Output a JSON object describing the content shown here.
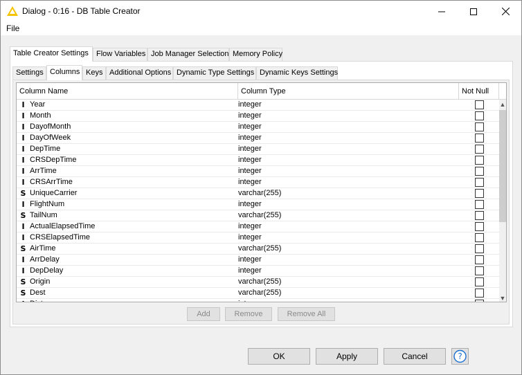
{
  "window": {
    "title": "Dialog - 0:16 - DB Table Creator"
  },
  "menu": {
    "file": "File"
  },
  "outer_tabs": [
    {
      "label": "Table Creator Settings",
      "active": true
    },
    {
      "label": "Flow Variables",
      "active": false
    },
    {
      "label": "Job Manager Selection",
      "active": false
    },
    {
      "label": "Memory Policy",
      "active": false
    }
  ],
  "inner_tabs": [
    {
      "label": "Settings",
      "active": false
    },
    {
      "label": "Columns",
      "active": true
    },
    {
      "label": "Keys",
      "active": false
    },
    {
      "label": "Additional Options",
      "active": false
    },
    {
      "label": "Dynamic Type Settings",
      "active": false
    },
    {
      "label": "Dynamic Keys Settings",
      "active": false
    }
  ],
  "table": {
    "headers": {
      "name": "Column Name",
      "type": "Column Type",
      "notnull": "Not Null"
    },
    "rows": [
      {
        "icon": "I",
        "name": "Year",
        "type": "integer",
        "notnull": false
      },
      {
        "icon": "I",
        "name": "Month",
        "type": "integer",
        "notnull": false
      },
      {
        "icon": "I",
        "name": "DayofMonth",
        "type": "integer",
        "notnull": false
      },
      {
        "icon": "I",
        "name": "DayOfWeek",
        "type": "integer",
        "notnull": false
      },
      {
        "icon": "I",
        "name": "DepTime",
        "type": "integer",
        "notnull": false
      },
      {
        "icon": "I",
        "name": "CRSDepTime",
        "type": "integer",
        "notnull": false
      },
      {
        "icon": "I",
        "name": "ArrTime",
        "type": "integer",
        "notnull": false
      },
      {
        "icon": "I",
        "name": "CRSArrTime",
        "type": "integer",
        "notnull": false
      },
      {
        "icon": "S",
        "name": "UniqueCarrier",
        "type": "varchar(255)",
        "notnull": false
      },
      {
        "icon": "I",
        "name": "FlightNum",
        "type": "integer",
        "notnull": false
      },
      {
        "icon": "S",
        "name": "TailNum",
        "type": "varchar(255)",
        "notnull": false
      },
      {
        "icon": "I",
        "name": "ActualElapsedTime",
        "type": "integer",
        "notnull": false
      },
      {
        "icon": "I",
        "name": "CRSElapsedTime",
        "type": "integer",
        "notnull": false
      },
      {
        "icon": "S",
        "name": "AirTime",
        "type": "varchar(255)",
        "notnull": false
      },
      {
        "icon": "I",
        "name": "ArrDelay",
        "type": "integer",
        "notnull": false
      },
      {
        "icon": "I",
        "name": "DepDelay",
        "type": "integer",
        "notnull": false
      },
      {
        "icon": "S",
        "name": "Origin",
        "type": "varchar(255)",
        "notnull": false
      },
      {
        "icon": "S",
        "name": "Dest",
        "type": "varchar(255)",
        "notnull": false
      },
      {
        "icon": "I",
        "name": "Distance",
        "type": "integer",
        "notnull": false
      }
    ]
  },
  "table_buttons": {
    "add": "Add",
    "remove": "Remove",
    "remove_all": "Remove All"
  },
  "dialog_buttons": {
    "ok": "OK",
    "apply": "Apply",
    "cancel": "Cancel"
  },
  "colors": {
    "warning_icon": "#f5c400"
  }
}
